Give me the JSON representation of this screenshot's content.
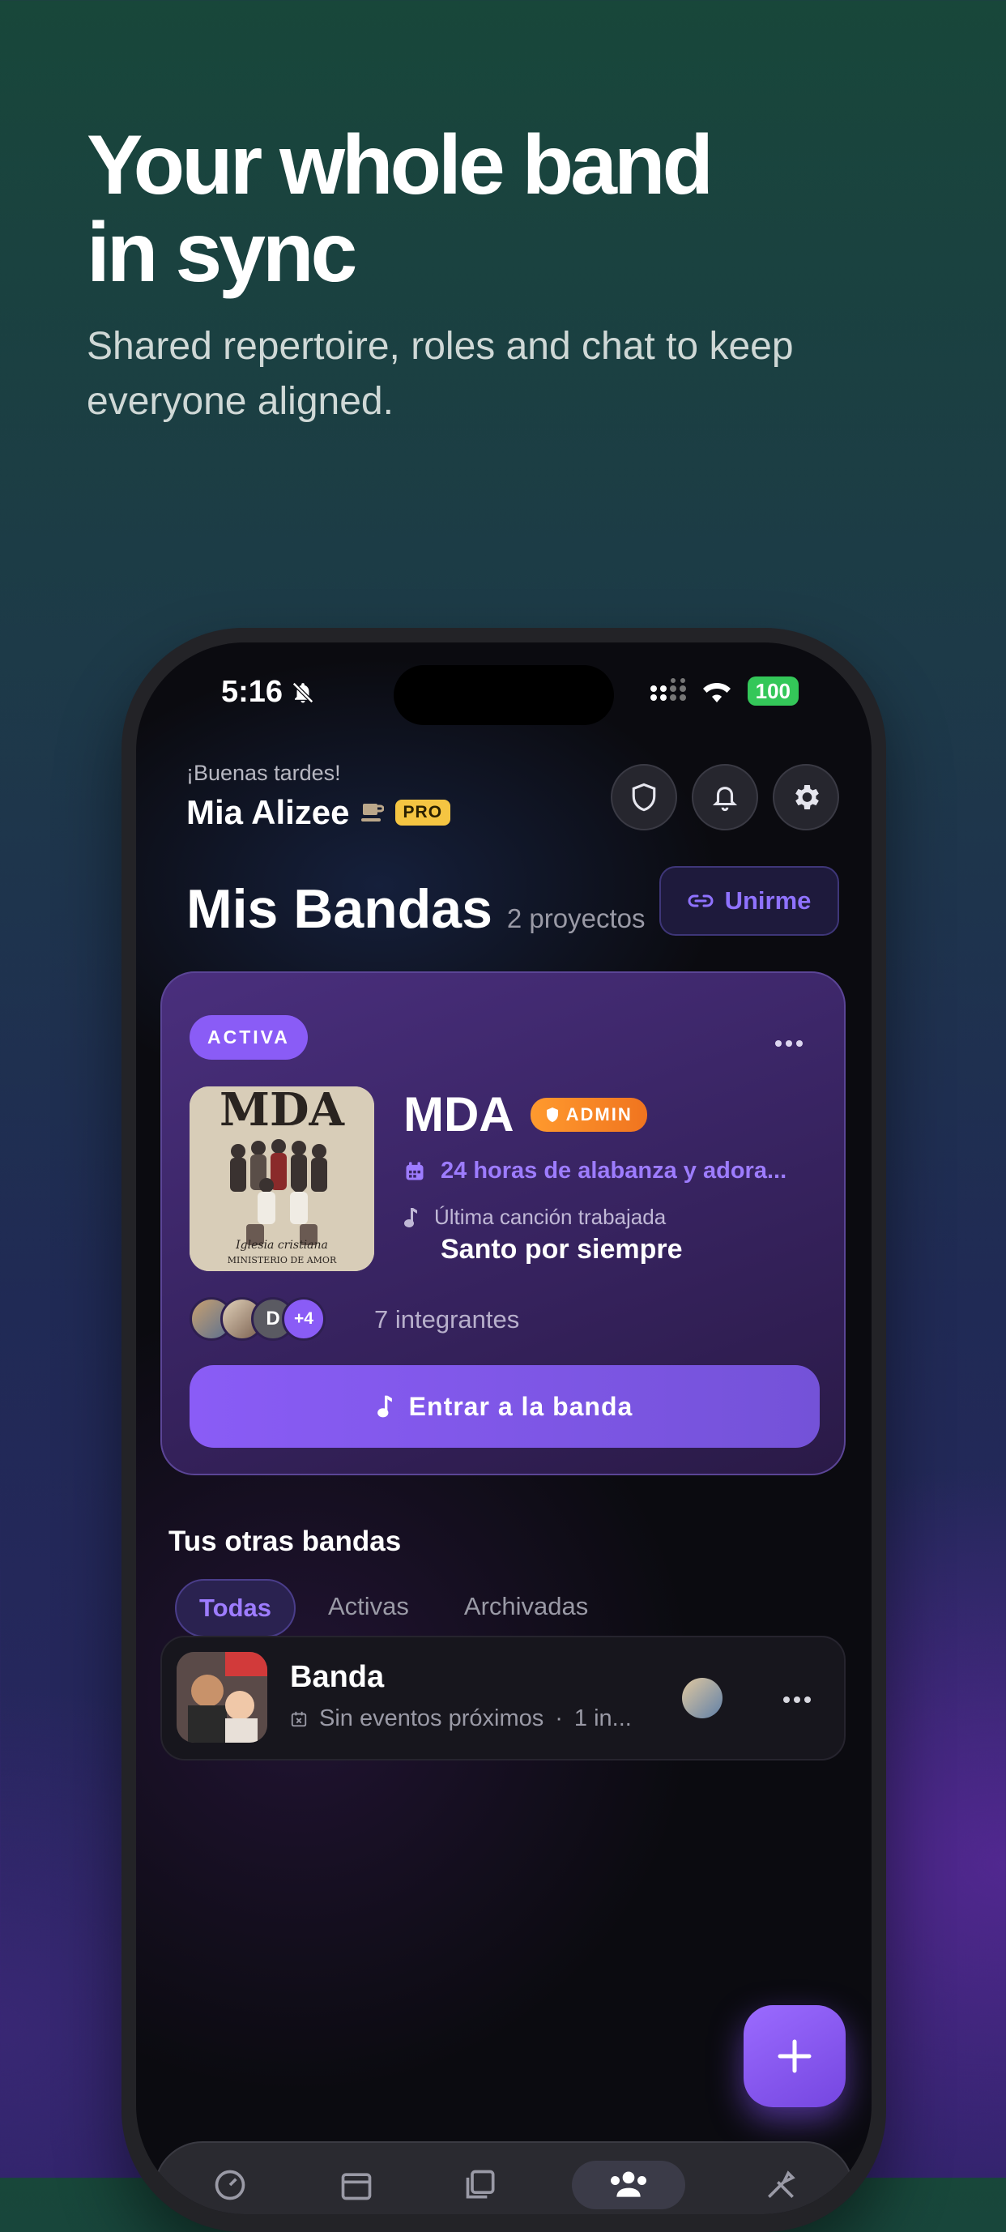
{
  "marketing": {
    "headline": "Your whole band\nin sync",
    "subheadline": "Shared repertoire, roles and chat to keep everyone aligned."
  },
  "status_bar": {
    "time": "5:16",
    "battery": "100"
  },
  "header": {
    "greeting": "¡Buenas tardes!",
    "username": "Mia Alizee",
    "badge": "PRO"
  },
  "section": {
    "title": "Mis Bandas",
    "count": "2 proyectos",
    "join_label": "Unirme"
  },
  "featured_band": {
    "status": "ACTIVA",
    "name": "MDA",
    "role": "ADMIN",
    "event": "24 horas de alabanza y adora...",
    "last_song_label": "Última canción trabajada",
    "last_song": "Santo por siempre",
    "avatar_initial": "D",
    "avatar_more": "+4",
    "members": "7 integrantes",
    "enter_label": "Entrar a la banda",
    "cover": {
      "logo": "MDA",
      "line1": "Iglesia cristiana",
      "line2": "MINISTERIO DE AMOR"
    }
  },
  "other_bands": {
    "title": "Tus otras bandas",
    "filters": [
      "Todas",
      "Activas",
      "Archivadas"
    ],
    "active_filter": "Todas",
    "items": [
      {
        "name": "Banda",
        "subtitle": "Sin eventos próximos",
        "members_short": "1 in..."
      }
    ]
  },
  "colors": {
    "accent": "#8a5cf6",
    "admin": "#f0741f",
    "pro": "#f5c542",
    "battery": "#34c759"
  },
  "icons": [
    "bell-slash-icon",
    "signal-icon",
    "wifi-icon",
    "shield-icon",
    "bell-icon",
    "gear-icon",
    "link-icon",
    "more-icon",
    "calendar-icon",
    "music-note-icon",
    "plus-icon"
  ]
}
